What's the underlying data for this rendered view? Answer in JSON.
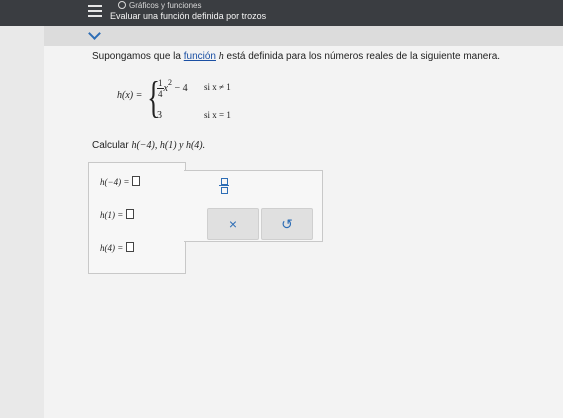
{
  "header": {
    "module": "Gráficos y funciones",
    "lesson": "Evaluar una función definida por trozos",
    "menu_icon": "hamburger-icon"
  },
  "problem": {
    "statement_before": "Supongamos que la ",
    "statement_link": "función",
    "statement_var": "h",
    "statement_after": " está definida para los números reales de la siguiente manera.",
    "lhs": "h(x) =",
    "case1_num": "1",
    "case1_den": "4",
    "case1_var": "x",
    "case1_exp": "2",
    "case1_rest": " − 4",
    "case1_cond": "si x ≠ 1",
    "case2_expr": "3",
    "case2_cond": "si x = 1",
    "calc_prefix": "Calcular ",
    "calc_items": "h(−4), h(1) y h(4)."
  },
  "answers": {
    "row1_label": "h(−4) =",
    "row2_label": "h(1) =",
    "row3_label": "h(4) ="
  },
  "tools": {
    "clear_symbol": "×",
    "undo_symbol": "↺"
  }
}
